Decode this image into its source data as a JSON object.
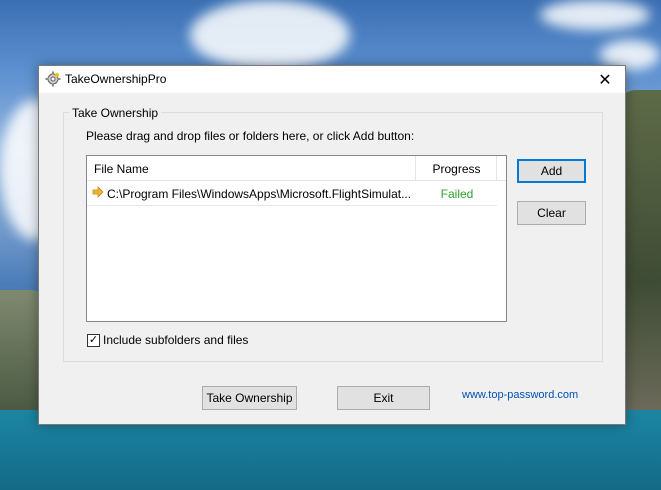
{
  "window": {
    "title": "TakeOwnershipPro",
    "close_glyph": "✕"
  },
  "group": {
    "title": "Take Ownership",
    "instruction": "Please drag and drop files or folders here, or click Add button:"
  },
  "list": {
    "columns": [
      "File Name",
      "Progress"
    ],
    "rows": [
      {
        "path": "C:\\Program Files\\WindowsApps\\Microsoft.FlightSimulat...",
        "status": "Failed",
        "status_color": "#2e9e2e",
        "icon": "arrow-right-icon"
      }
    ]
  },
  "buttons": {
    "add": "Add",
    "clear": "Clear",
    "take_ownership": "Take Ownership",
    "exit": "Exit"
  },
  "options": {
    "include_subfolders_label": "Include subfolders and files",
    "include_subfolders_checked": true,
    "check_glyph": "✓"
  },
  "footer": {
    "link": "www.top-password.com"
  },
  "colors": {
    "accent": "#0078d7",
    "link": "#0050b4",
    "success": "#2e9e2e"
  }
}
